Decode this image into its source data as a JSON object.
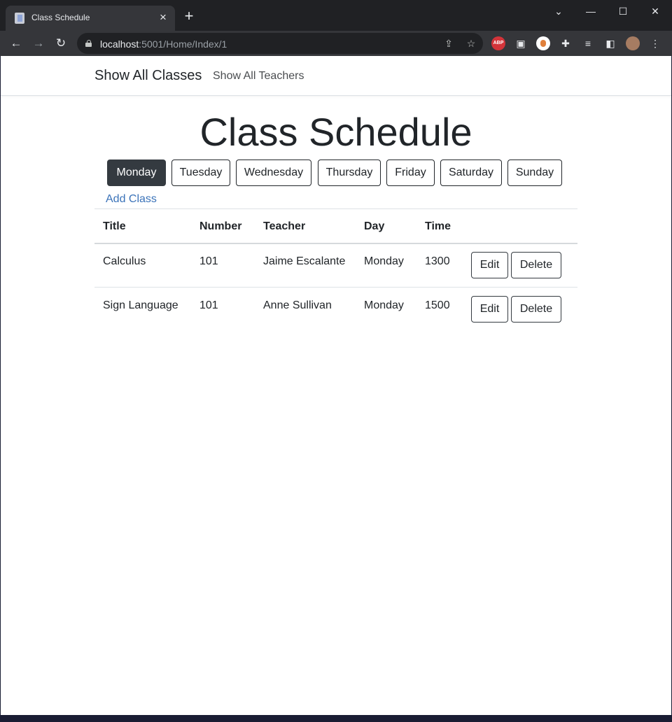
{
  "browser": {
    "tab_title": "Class Schedule",
    "url_host": "localhost",
    "url_path": ":5001/Home/Index/1",
    "icons": [
      "file-icon",
      "close-icon",
      "plus-icon",
      "chevron-down-icon",
      "minimize-icon",
      "maximize-icon",
      "close-window-icon",
      "back-arrow-icon",
      "forward-arrow-icon",
      "reload-icon",
      "lock-icon",
      "share-icon",
      "star-icon",
      "adblock-icon",
      "extension-icon",
      "puzzle-icon",
      "reading-list-icon",
      "side-panel-icon",
      "avatar",
      "kebab-menu-icon"
    ],
    "abp_label": "ABP"
  },
  "navbar": {
    "brand": "Show All Classes",
    "link": "Show All Teachers"
  },
  "main": {
    "title": "Class Schedule",
    "days": [
      "Monday",
      "Tuesday",
      "Wednesday",
      "Thursday",
      "Friday",
      "Saturday",
      "Sunday"
    ],
    "active_day": "Monday",
    "add_link": "Add Class",
    "table": {
      "headers": [
        "Title",
        "Number",
        "Teacher",
        "Day",
        "Time"
      ],
      "rows": [
        {
          "title": "Calculus",
          "number": "101",
          "teacher": "Jaime Escalante",
          "day": "Monday",
          "time": "1300",
          "edit": "Edit",
          "delete": "Delete"
        },
        {
          "title": "Sign Language",
          "number": "101",
          "teacher": "Anne Sullivan",
          "day": "Monday",
          "time": "1500",
          "edit": "Edit",
          "delete": "Delete"
        }
      ]
    }
  },
  "colors": {
    "active_day_bg": "#343a40",
    "link": "#3b73b9",
    "chrome_dark": "#202124",
    "chrome_toolbar": "#35363a"
  }
}
